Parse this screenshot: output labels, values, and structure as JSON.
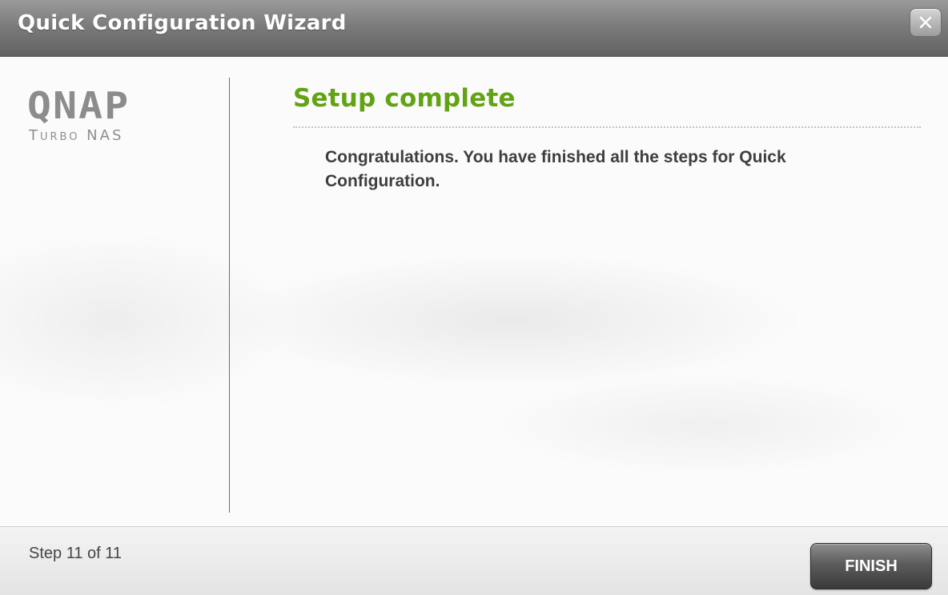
{
  "window": {
    "title": "Quick Configuration Wizard",
    "close_icon": "close-x-icon"
  },
  "logo": {
    "main": "QNAP",
    "sub": "Turbo NAS"
  },
  "main": {
    "heading": "Setup complete",
    "message": "Congratulations. You have finished all the steps for Quick Configuration."
  },
  "footer": {
    "step_text": "Step 11 of 11",
    "finish_label": "FINISH"
  },
  "colors": {
    "heading_green": "#62a314",
    "titlebar_gray": "#7c7c7c"
  }
}
